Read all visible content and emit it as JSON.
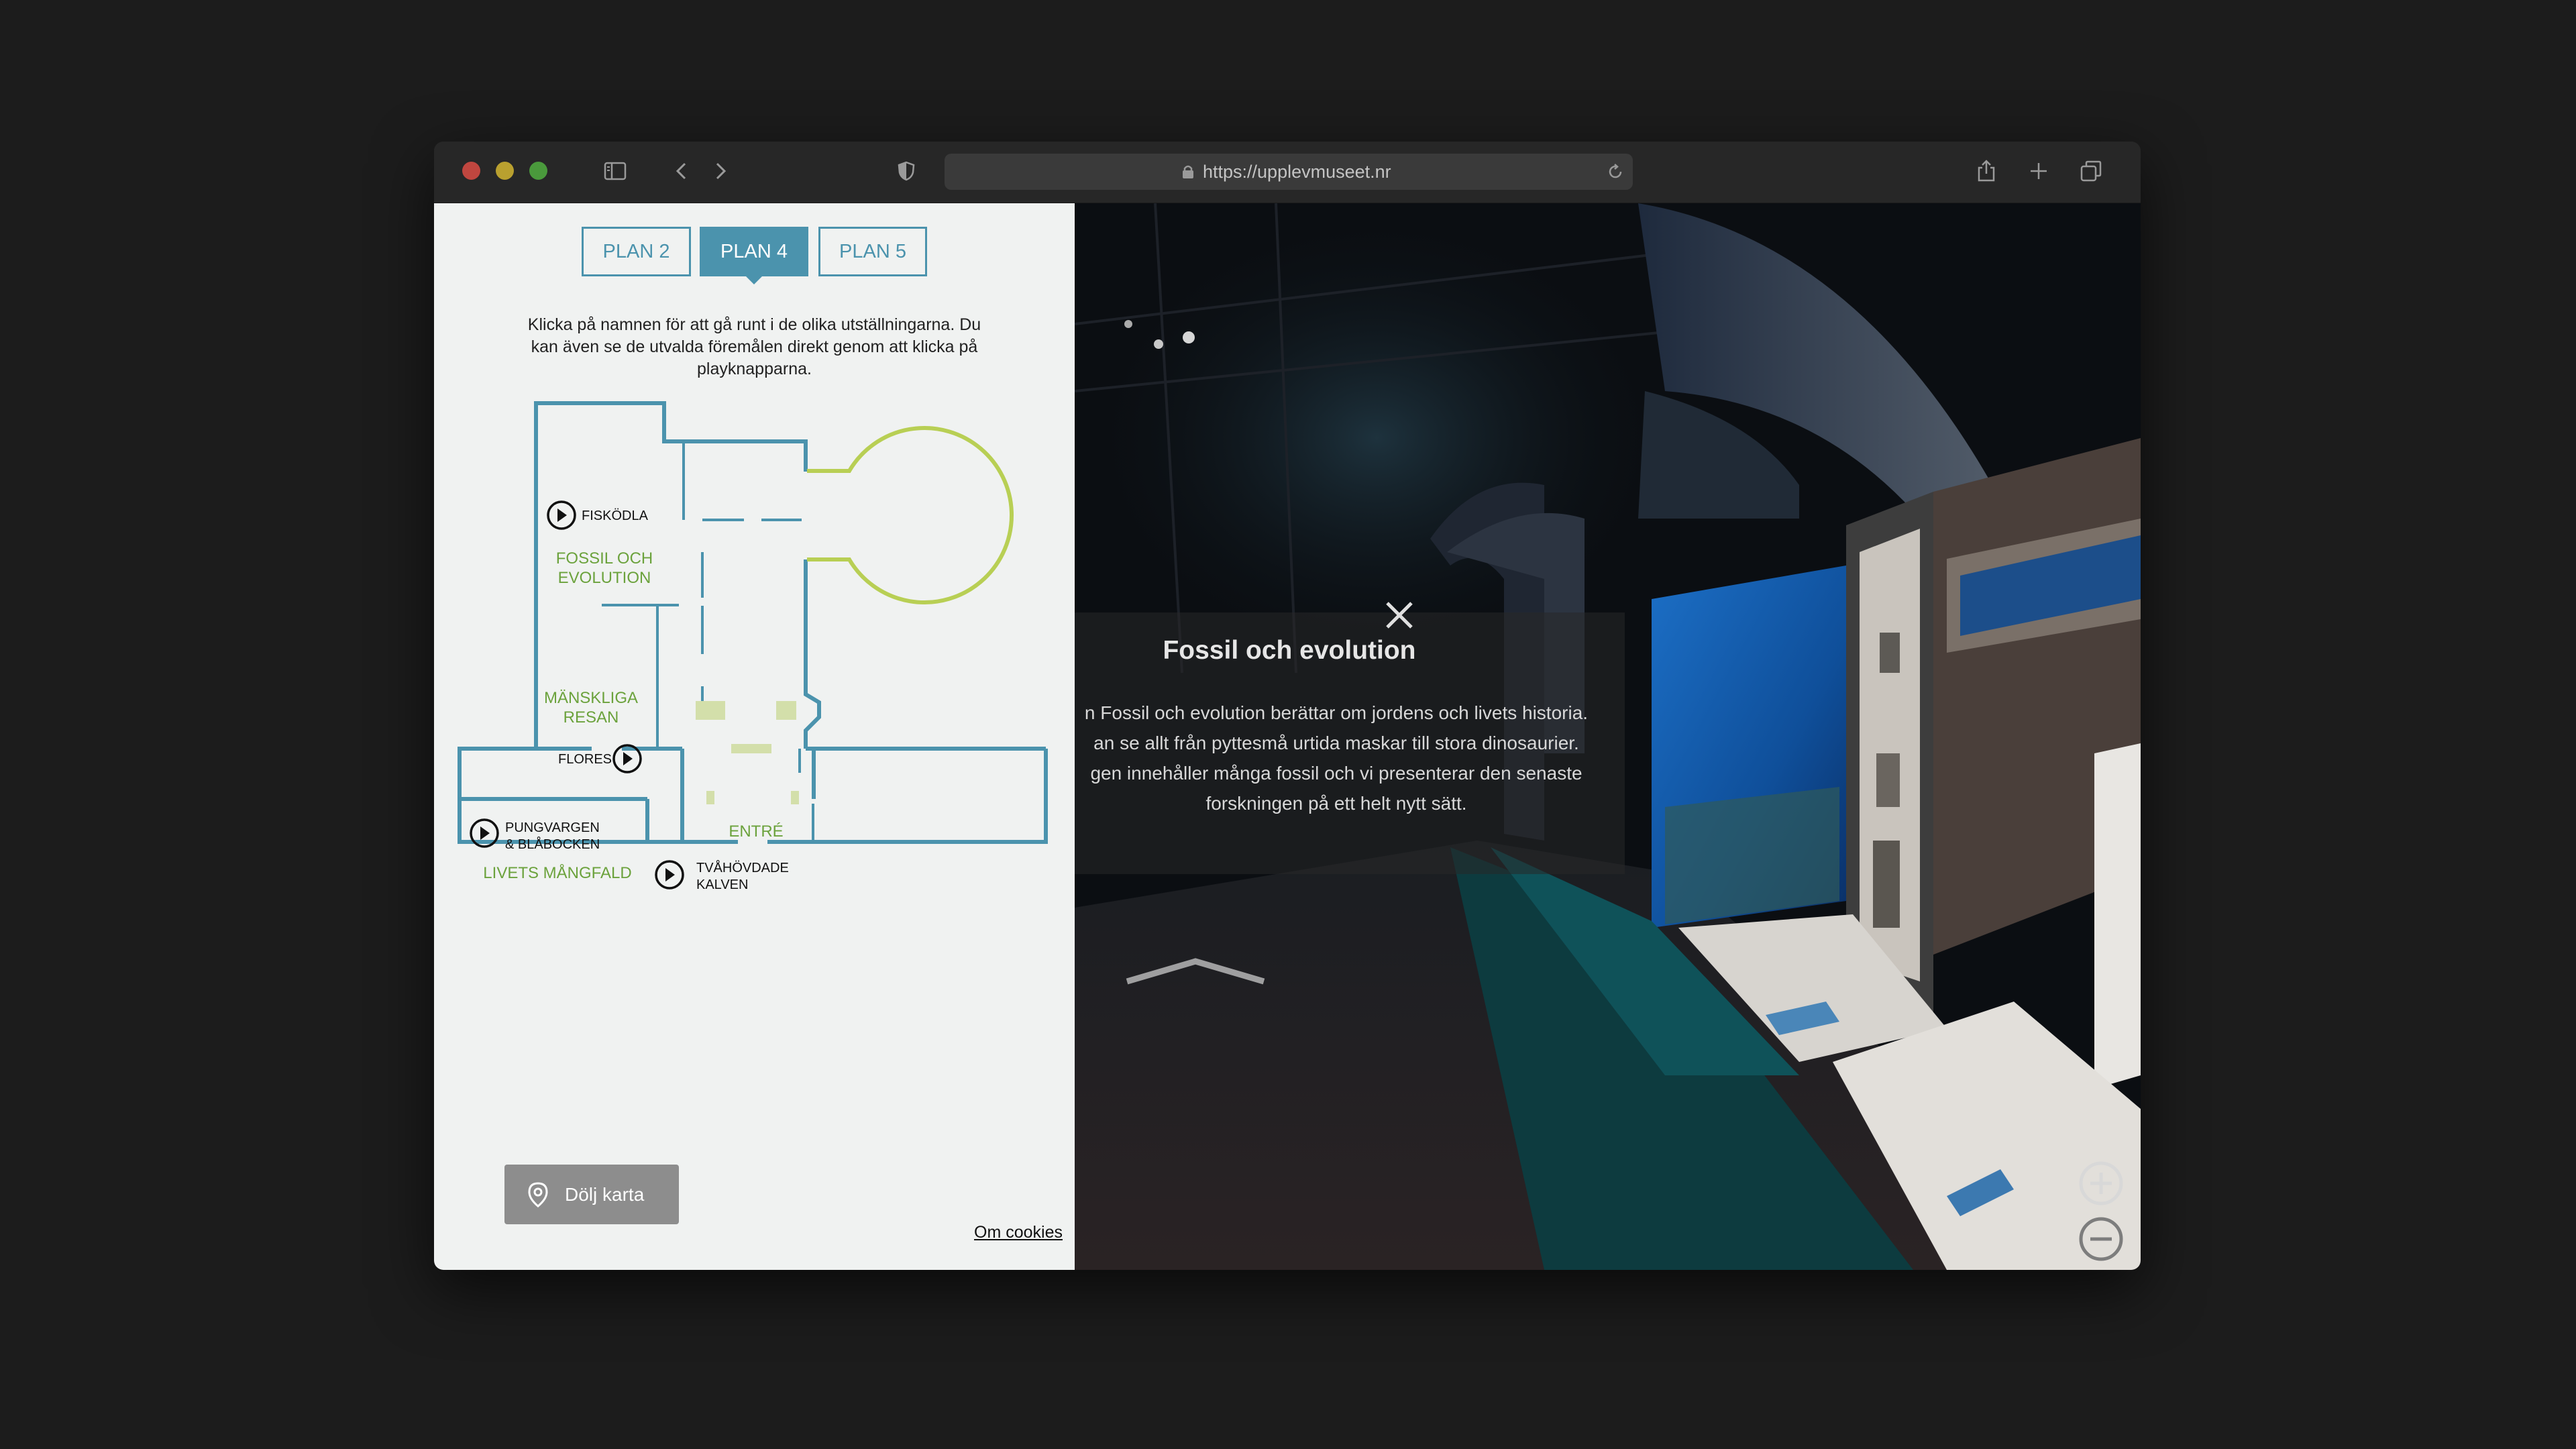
{
  "browser": {
    "url": "https://upplevmuseet.nr",
    "traffic_lights": [
      "#c0463f",
      "#b9a02f",
      "#4a9a3c"
    ],
    "icons": [
      "sidebar-icon",
      "back-icon",
      "forward-icon",
      "shield-icon",
      "lock-icon",
      "reload-icon",
      "share-icon",
      "new-tab-icon",
      "tabs-icon"
    ]
  },
  "floor_tabs": [
    {
      "label": "PLAN 2",
      "active": false
    },
    {
      "label": "PLAN 4",
      "active": true
    },
    {
      "label": "PLAN 5",
      "active": false
    }
  ],
  "instructions": "Klicka på namnen för att gå runt i de olika utställningarna. Du kan även se de utvalda föremålen direkt genom att klicka på playknapparna.",
  "map": {
    "rooms": {
      "fossil": "FOSSIL OCH",
      "fossil2": "EVOLUTION",
      "mansk": "MÄNSKLIGA",
      "mansk2": "RESAN",
      "entre": "ENTRÉ",
      "livets": "LIVETS MÅNGFALD"
    },
    "items": {
      "fiskodla": "FISKÖDLA",
      "flores": "FLORES",
      "pungvargen": "PUNGVARGEN",
      "pungvargen2": "& BLÅBOCKEN",
      "tvahovdade": "TVÅHÖVDADE",
      "tvahovdade2": "KALVEN"
    },
    "colors": {
      "walls": "#4b93ad",
      "rooms": "#6ba23c",
      "rotunda": "#b8cf54"
    }
  },
  "hide_map_label": "Dölj karta",
  "cookies_label": "Om cookies",
  "scene": {
    "title": "Fossil och evolution",
    "body": [
      "n Fossil och evolution berättar om jordens och livets historia.",
      "an se allt från pyttesmå urtida maskar till stora dinosaurier.",
      "gen innehåller många fossil och vi presenterar den senaste",
      "forskningen på ett helt nytt sätt."
    ]
  }
}
